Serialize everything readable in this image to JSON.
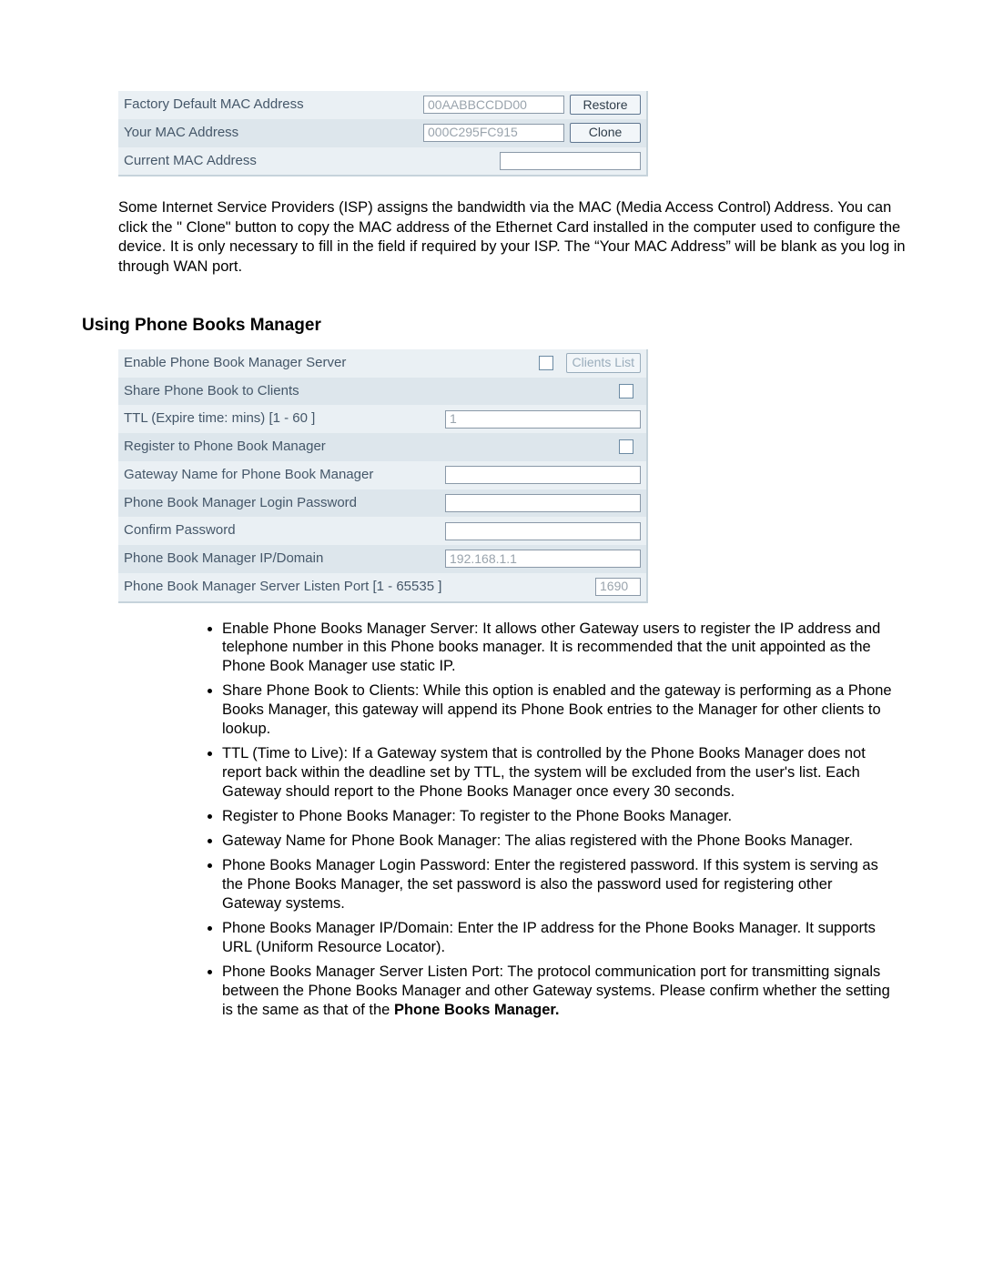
{
  "mac": {
    "rows": [
      {
        "label": "Factory Default MAC Address",
        "value": "00AABBCCDD00",
        "button": "Restore"
      },
      {
        "label": "Your MAC Address",
        "value": "000C295FC915",
        "button": "Clone"
      },
      {
        "label": "Current MAC Address",
        "value": "",
        "button": ""
      }
    ]
  },
  "mac_para": "Some Internet Service Providers (ISP) assigns the bandwidth via the MAC (Media Access Control) Address. You can click the \" Clone\" button to copy the MAC address of the Ethernet Card installed in the computer used to configure the device. It is only necessary to fill in the field if required by your ISP. The “Your MAC Address” will be blank as you log in through WAN port.",
  "heading": "Using Phone Books Manager",
  "pbm": {
    "enable_label": "Enable Phone Book Manager Server",
    "clients_btn": "Clients List",
    "share_label": "Share Phone Book to Clients",
    "ttl_label": "TTL (Expire time: mins) [1 - 60 ]",
    "ttl_value": "1",
    "register_label": "Register to Phone Book Manager",
    "gw_name_label": "Gateway Name for Phone Book Manager",
    "pw_label": "Phone Book Manager Login Password",
    "confirm_label": "Confirm Password",
    "ipdomain_label": "Phone Book Manager IP/Domain",
    "ipdomain_value": "192.168.1.1",
    "port_label": "Phone Book Manager Server Listen Port [1 - 65535 ]",
    "port_value": "1690"
  },
  "bullets": [
    "Enable Phone Books Manager Server: It allows other Gateway users to register the IP address and telephone number in this Phone books manager. It is recommended that the unit appointed as the Phone Book Manager use static IP.",
    "Share Phone Book to Clients: While this option is enabled and the gateway is performing as a Phone Books Manager, this gateway will append its Phone Book entries to the Manager for other clients to lookup.",
    "TTL (Time to Live): If a Gateway system that is controlled by the Phone Books Manager does not report back within the deadline set by TTL, the system will be excluded from the user's list. Each Gateway should report to the Phone Books Manager once every 30 seconds.",
    "Register to Phone Books Manager: To register to the Phone Books Manager.",
    "Gateway Name for Phone Book Manager: The alias registered with the Phone Books Manager.",
    "Phone Books Manager Login Password: Enter the registered password. If this system is serving as the Phone Books Manager, the set password is also the password used for registering other Gateway systems.",
    "Phone Books Manager IP/Domain: Enter the IP address for the Phone Books Manager. It supports URL (Uniform Resource Locator)."
  ],
  "last_bullet_pre": "Phone Books Manager Server Listen Port: The protocol communication port for transmitting signals between the Phone Books Manager and other Gateway systems.   Please confirm whether the setting is the same as that of the ",
  "last_bullet_bold": "Phone Books Manager."
}
